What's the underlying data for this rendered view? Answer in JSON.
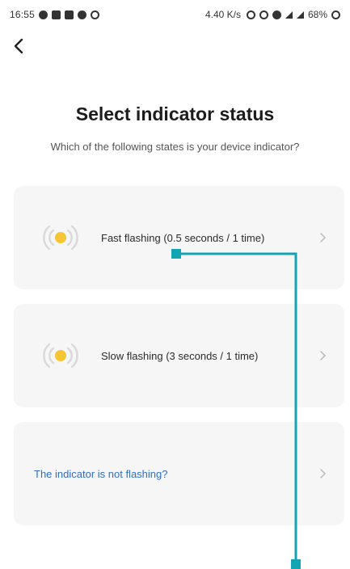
{
  "status_bar": {
    "time": "16:55",
    "net_speed": "4.40 K/s",
    "battery": "68%"
  },
  "header": {
    "title": "Select indicator status",
    "subtitle": "Which of the following states is your device indicator?"
  },
  "options": [
    {
      "label": "Fast flashing (0.5 seconds / 1 time)"
    },
    {
      "label": "Slow flashing (3 seconds / 1 time)"
    },
    {
      "label": "The indicator is not flashing?"
    }
  ],
  "colors": {
    "indicator_dot": "#f5c534",
    "indicator_wave": "#d9d9d9",
    "link": "#2f6fbf",
    "annotation_line": "#14a5b5",
    "card_bg": "#f6f6f6"
  },
  "icons": {
    "back": "chevron-left-icon",
    "indicator": "flashing-indicator-icon",
    "chevron": "chevron-right-icon"
  }
}
